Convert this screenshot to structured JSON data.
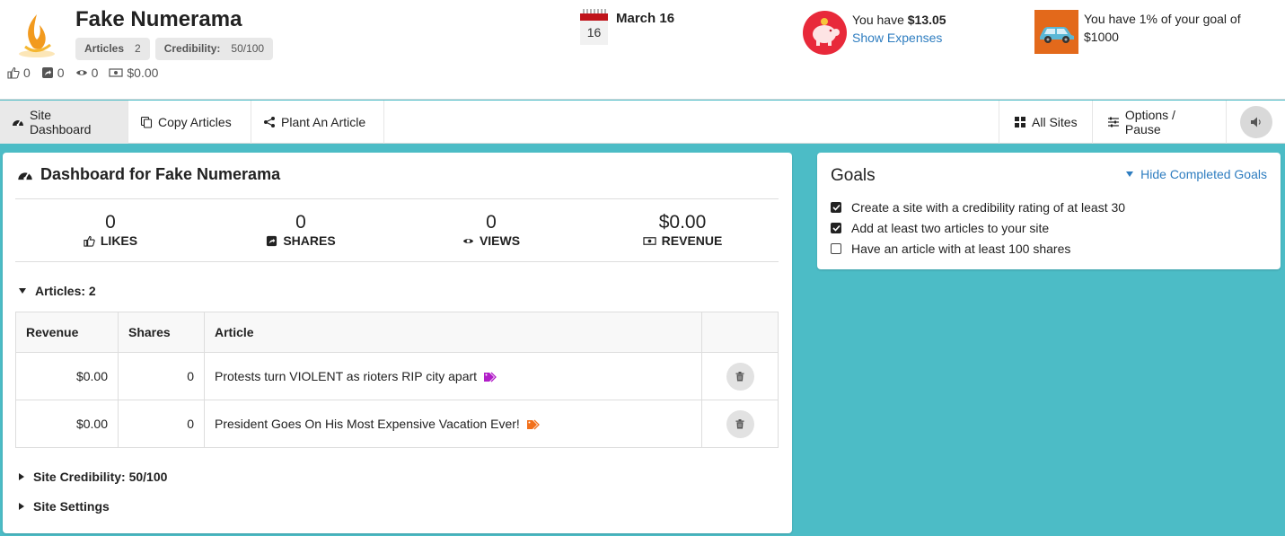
{
  "header": {
    "site_title": "Fake Numerama",
    "labels": [
      {
        "name": "Articles",
        "value": "2"
      },
      {
        "name": "Credibility:",
        "value": "50/100"
      }
    ],
    "stats": {
      "likes": "0",
      "shares": "0",
      "views": "0",
      "revenue": "$0.00"
    },
    "date": {
      "day": "16",
      "text": "March 16"
    },
    "money": {
      "prefix": "You have ",
      "amount": "$13.05",
      "link": "Show Expenses"
    },
    "goal": {
      "line1": "You have 1% of your goal of",
      "line2": "$1000"
    }
  },
  "nav": {
    "left": [
      "Site Dashboard",
      "Copy Articles",
      "Plant An Article"
    ],
    "right": [
      "All Sites",
      "Options / Pause"
    ],
    "active": "Site Dashboard"
  },
  "dashboard": {
    "title": "Dashboard for Fake Numerama",
    "stats": [
      {
        "value": "0",
        "label": "LIKES",
        "icon": "thumbs-up-icon"
      },
      {
        "value": "0",
        "label": "SHARES",
        "icon": "share-square-icon"
      },
      {
        "value": "0",
        "label": "VIEWS",
        "icon": "eye-icon"
      },
      {
        "value": "$0.00",
        "label": "REVENUE",
        "icon": "money-bill-icon"
      }
    ],
    "articles_heading": "Articles: 2",
    "table": {
      "columns": [
        "Revenue",
        "Shares",
        "Article"
      ],
      "rows": [
        {
          "revenue": "$0.00",
          "shares": "0",
          "article": "Protests turn VIOLENT as rioters RIP city apart",
          "tag_color": "#b11ec8"
        },
        {
          "revenue": "$0.00",
          "shares": "0",
          "article": "President Goes On His Most Expensive Vacation Ever!",
          "tag_color": "#f2711c"
        }
      ]
    },
    "credibility_heading": "Site Credibility: 50/100",
    "settings_heading": "Site Settings"
  },
  "goals": {
    "title": "Goals",
    "hide_link": "Hide Completed Goals",
    "items": [
      {
        "text": "Create a site with a credibility rating of at least 30",
        "checked": true
      },
      {
        "text": "Add at least two articles to your site",
        "checked": true
      },
      {
        "text": "Have an article with at least 100 shares",
        "checked": false
      }
    ]
  },
  "colors": {
    "background": "#4cbcc6",
    "link": "#2e7dc0",
    "calendar_red": "#c0141b",
    "piggy_red": "#e8293a",
    "car_orange": "#e3691b"
  }
}
